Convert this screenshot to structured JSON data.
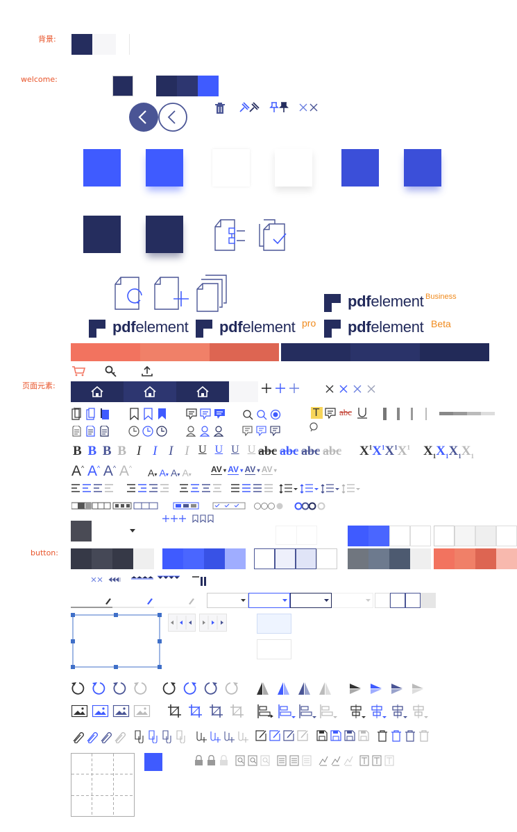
{
  "labels": {
    "background": "背景:",
    "welcome": "welcome:",
    "page_elements": "页面元素:",
    "button": "button:"
  },
  "colors": {
    "navy": "#252d5e",
    "blue": "#3f5bff",
    "blue_dark": "#3b4fd9",
    "light": "#f6f6f8",
    "coral": "#f2735f",
    "grey_dark": "#3a3d4a",
    "slate": "#6d7a8e"
  },
  "logos": [
    {
      "name": "pdfelement",
      "suffix": ""
    },
    {
      "name": "pdfelement",
      "suffix": "pro"
    },
    {
      "name": "pdfelement",
      "suffix": "Business"
    },
    {
      "name": "pdfelement",
      "suffix": "Beta"
    }
  ],
  "logo_text": {
    "bold": "pdf",
    "rest": "element"
  },
  "icons": [
    "back-arrow-icon",
    "trash-icon",
    "pin-icon",
    "close-icon",
    "cart-icon",
    "search-icon",
    "upload-icon",
    "home-icon",
    "plus-icon",
    "bookmark-icon",
    "comment-icon",
    "clock-icon",
    "user-icon",
    "bold-icon",
    "italic-icon",
    "underline-icon",
    "strikethrough-icon",
    "superscript-icon",
    "subscript-icon",
    "font-size-icon",
    "char-spacing-icon",
    "align-icon",
    "line-spacing-icon",
    "rotate-left-icon",
    "rotate-right-icon",
    "flip-icon",
    "image-icon",
    "crop-icon",
    "align-left-icon",
    "distribute-icon",
    "attach-icon",
    "edit-icon",
    "save-icon",
    "lock-icon",
    "zoom-page-icon",
    "doc-icon",
    "signature-icon",
    "text-field-icon"
  ],
  "text_format": {
    "bold": "B",
    "italic": "I",
    "underline": "U",
    "strike": "abc",
    "sup_base": "X",
    "sup_mark": "1",
    "font_a": "A",
    "spacing": "AV",
    "highlight_t": "T"
  }
}
